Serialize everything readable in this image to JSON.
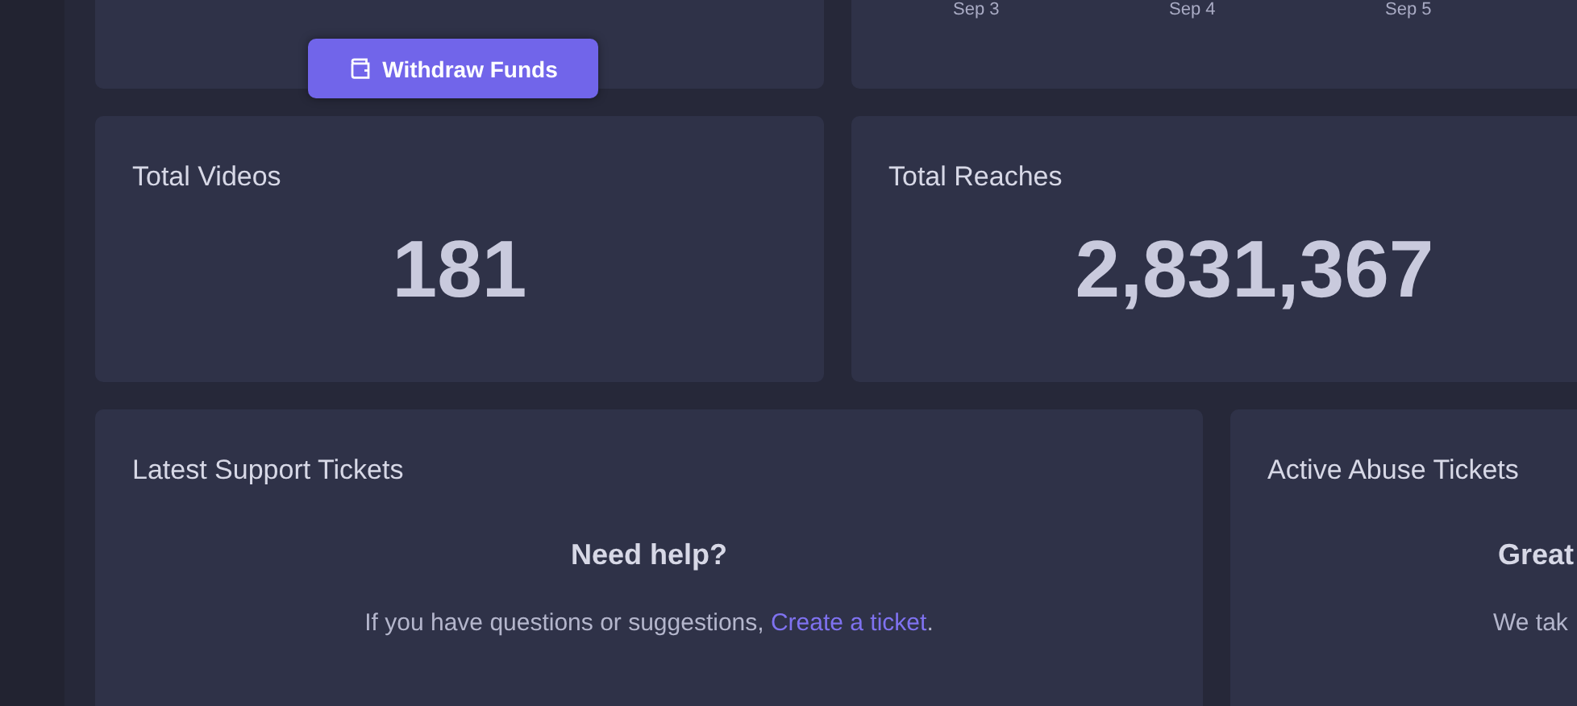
{
  "wallet_card": {
    "button": "Withdraw Funds"
  },
  "chart_card": {
    "x_labels": [
      "Sep 3",
      "Sep 4",
      "Sep 5"
    ]
  },
  "stats": [
    {
      "title": "Total Videos",
      "value": "181"
    },
    {
      "title": "Total Reaches",
      "value": "2,831,367"
    }
  ],
  "support_tickets": {
    "title": "Latest Support Tickets",
    "heading": "Need help?",
    "text": "If you have questions or suggestions, ",
    "link": "Create a ticket",
    "after": "."
  },
  "abuse_tickets": {
    "title": "Active Abuse Tickets",
    "heading": "Great",
    "text": "We tak"
  }
}
